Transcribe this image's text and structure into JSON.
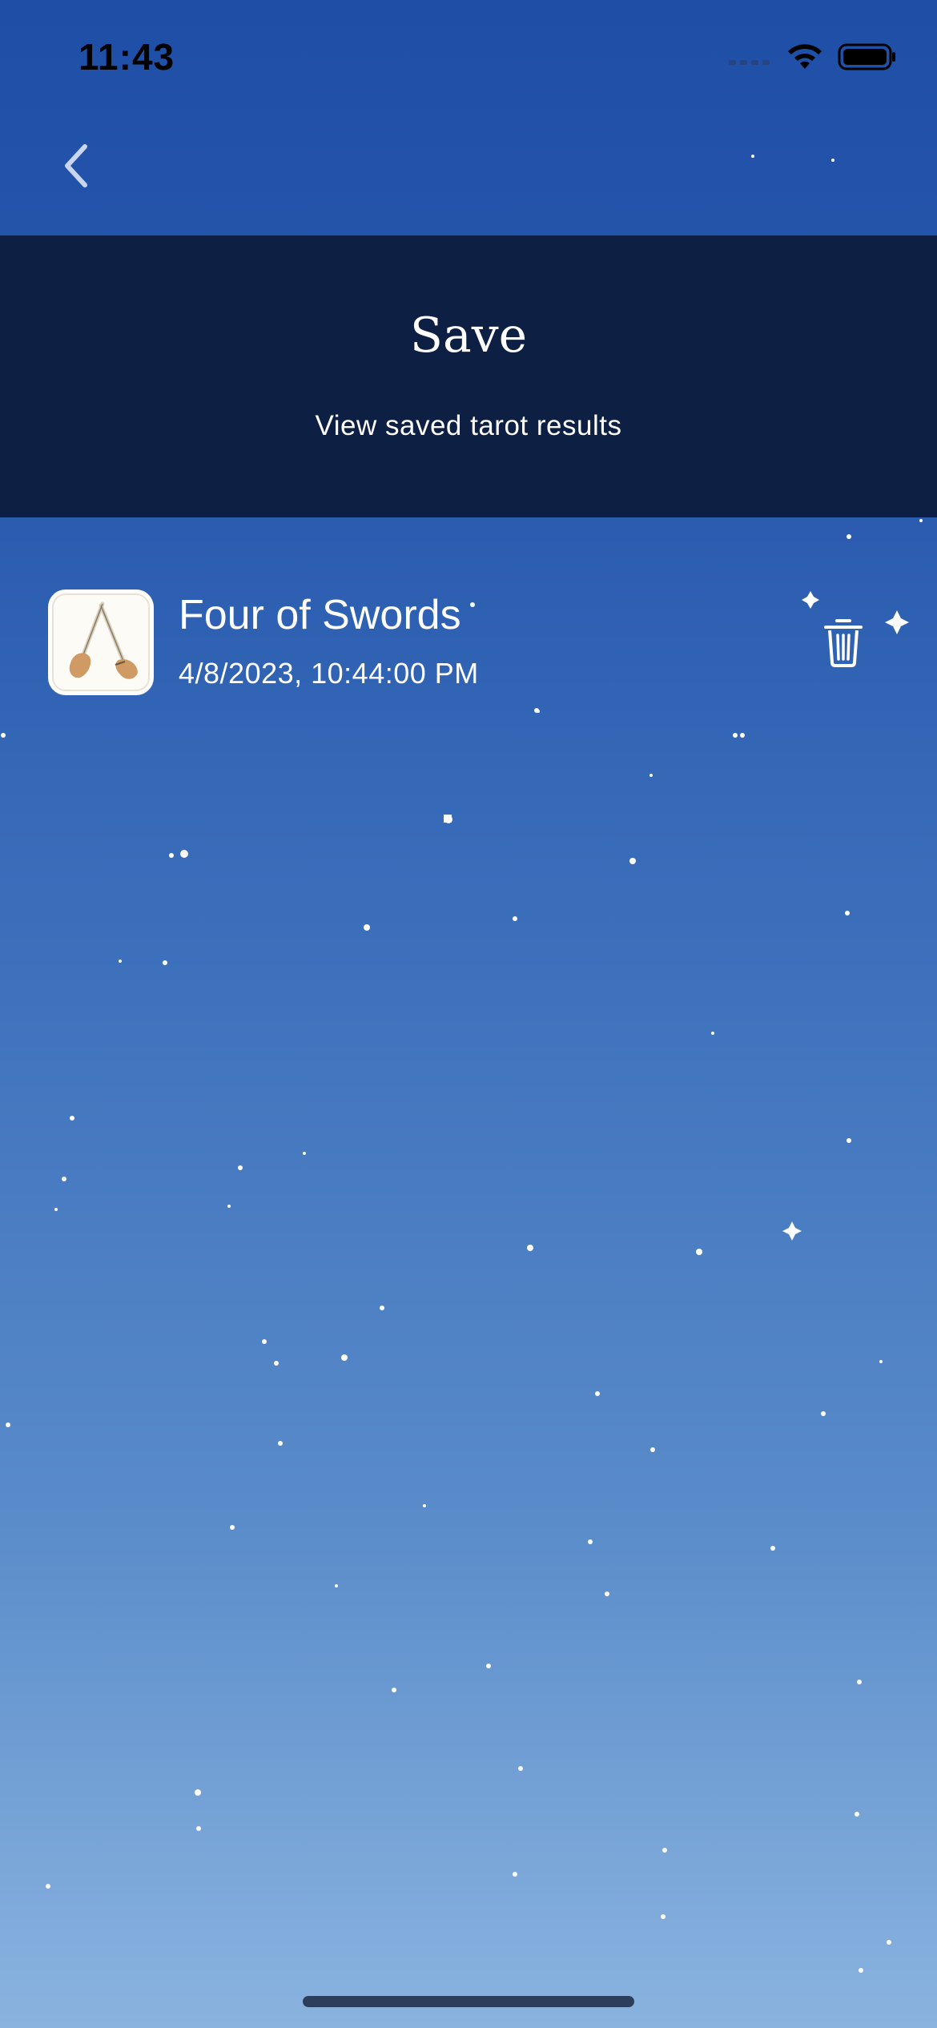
{
  "status_bar": {
    "time": "11:43",
    "icons": [
      "cellular-signal-icon",
      "wifi-icon",
      "battery-icon"
    ]
  },
  "nav": {
    "back_icon": "chevron-left-icon"
  },
  "header": {
    "title": "Save",
    "subtitle": "View saved tarot results"
  },
  "saved_results": [
    {
      "card_name": "Four of Swords",
      "saved_at": "4/8/2023, 10:44:00 PM",
      "thumbnail_icon": "tarot-card-icon",
      "delete_icon": "trash-icon"
    }
  ],
  "colors": {
    "header_background": "#0d1f42",
    "sky_top": "#1e4ea6",
    "sky_bottom": "#8ab3df",
    "text": "#ffffff"
  }
}
